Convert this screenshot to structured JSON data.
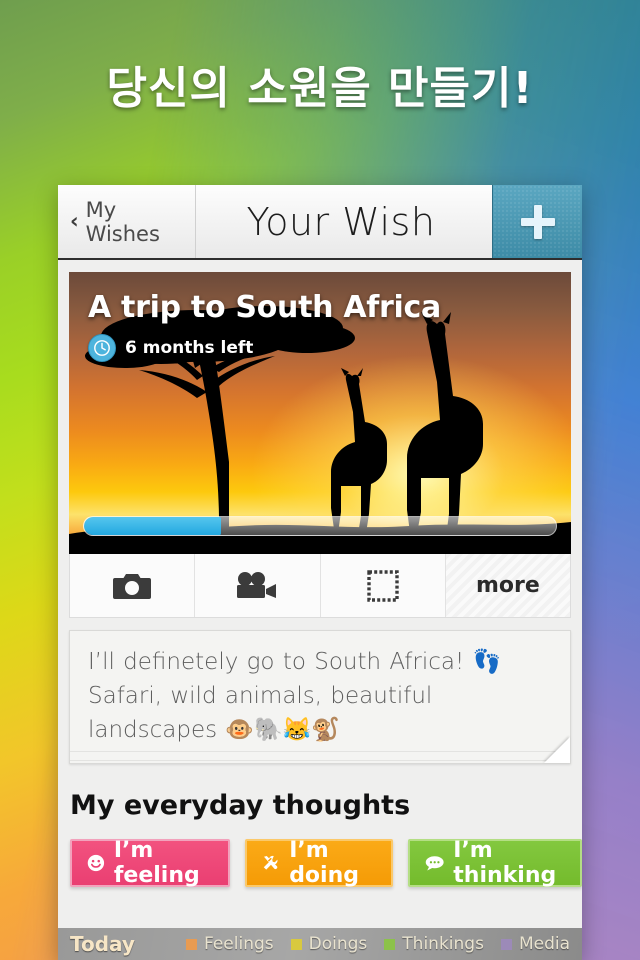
{
  "background": {
    "top_left_color": "#6f9e4e",
    "top_right_color": "#2b7f9e",
    "bottom_left_color": "#f5a33c",
    "bottom_right_color": "#a184cf"
  },
  "headline": "당신의 소원을 만들기!",
  "navbar": {
    "back_chevron": "‹",
    "back_label": "My Wishes",
    "title": "Your Wish",
    "add_label": "+",
    "add_bg": "#4a93ab"
  },
  "hero": {
    "title": "A trip to South Africa",
    "time_left": "6 months left",
    "clock_icon": "clock-icon",
    "progress_percent": 29,
    "progress_color": "#35b5e6"
  },
  "mediabar": {
    "items": [
      {
        "icon": "camera-icon",
        "label": ""
      },
      {
        "icon": "video-camera-icon",
        "label": ""
      },
      {
        "icon": "stamp-frame-icon",
        "label": ""
      },
      {
        "icon": "",
        "label": "more"
      }
    ]
  },
  "note": {
    "text": "I’ll definetely go to South Africa! 👣 Safari, wild animals, beautiful landscapes 🐵🐘😹🐒"
  },
  "everyday": {
    "title": "My everyday thoughts",
    "buttons": [
      {
        "label": "I’m feeling",
        "icon": "smiley-icon",
        "color": "#ef4a7b"
      },
      {
        "label": "I’m doing",
        "icon": "tools-icon",
        "color": "#f9a40d"
      },
      {
        "label": "I’m thinking",
        "icon": "speech-bubble-icon",
        "color": "#7cc135"
      }
    ]
  },
  "legendbar": {
    "today_label": "Today",
    "items": [
      {
        "label": "Feelings",
        "color": "#e89b52"
      },
      {
        "label": "Doings",
        "color": "#d8c93f"
      },
      {
        "label": "Thinkings",
        "color": "#8cc24a"
      },
      {
        "label": "Media",
        "color": "#9c8ab8"
      }
    ]
  }
}
